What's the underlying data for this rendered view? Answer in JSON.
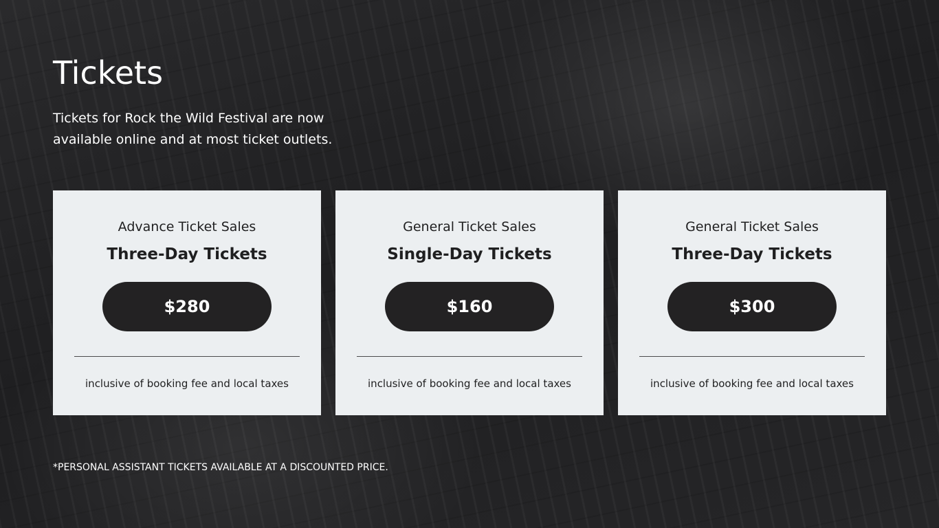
{
  "header": {
    "title": "Tickets",
    "intro": "Tickets for Rock the Wild Festival are now available online and at most ticket outlets."
  },
  "cards": [
    {
      "category": "Advance Ticket Sales",
      "kind": "Three-Day Tickets",
      "price": "$280",
      "note": "inclusive of booking fee and local taxes"
    },
    {
      "category": "General Ticket Sales",
      "kind": "Single-Day Tickets",
      "price": "$160",
      "note": "inclusive of booking fee and local taxes"
    },
    {
      "category": "General Ticket Sales",
      "kind": "Three-Day Tickets",
      "price": "$300",
      "note": "inclusive of booking fee and local taxes"
    }
  ],
  "footnote": "*PERSONAL ASSISTANT TICKETS AVAILABLE AT A DISCOUNTED PRICE.",
  "colors": {
    "background": "#1d1d1f",
    "card": "#eceff1",
    "price_pill": "#232223",
    "text_dark": "#1f1f20",
    "text_light": "#ffffff"
  }
}
